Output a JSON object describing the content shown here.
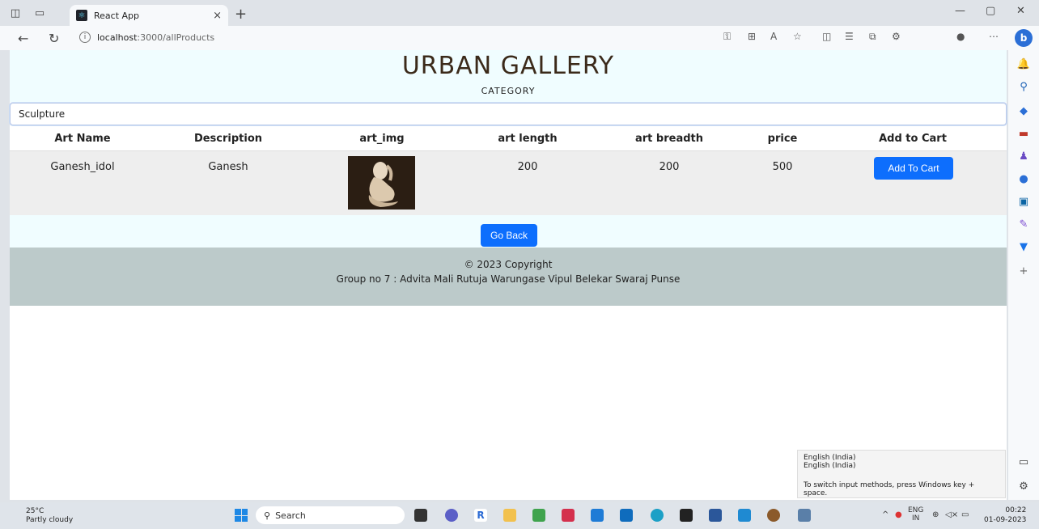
{
  "browser": {
    "tab_title": "React App",
    "url_host": "localhost",
    "url_path": ":3000/allProducts"
  },
  "page": {
    "brand": "URBAN GALLERY",
    "category_label": "CATEGORY",
    "selected_category": "Sculpture",
    "columns": [
      "Art Name",
      "Description",
      "art_img",
      "art length",
      "art breadth",
      "price",
      "Add to Cart"
    ],
    "rows": [
      {
        "art_name": "Ganesh_idol",
        "description": "Ganesh",
        "art_length": "200",
        "art_breadth": "200",
        "price": "500",
        "action": "Add To Cart"
      }
    ],
    "go_back": "Go Back",
    "copyright": "© 2023 Copyright",
    "group": "Group no 7 : Advita Mali Rutuja Warungase Vipul Belekar Swaraj Punse"
  },
  "ime_popup": {
    "line1": "English (India)",
    "line2": "English (India)",
    "hint": "To switch input methods, press Windows key + space."
  },
  "taskbar": {
    "temp": "25°C",
    "weather": "Partly cloudy",
    "search": "Search",
    "lang_top": "ENG",
    "lang_bottom": "IN",
    "time": "00:22",
    "date": "01-09-2023"
  },
  "colors": {
    "primary_button": "#0d6efd",
    "header_bg": "#f0fdff",
    "footer_bg": "#bccaca"
  }
}
